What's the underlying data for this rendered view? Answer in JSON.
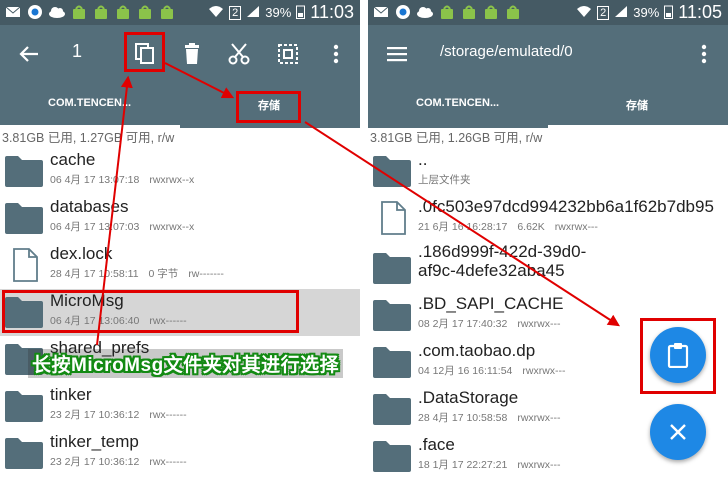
{
  "colors": {
    "statusbar": "#455a64",
    "toolbar": "#546e7a",
    "fab": "#1e88e5",
    "annotation": "#e00000",
    "caption_outline": "#138a13"
  },
  "left": {
    "status": {
      "battery": "39%",
      "time": "11:03",
      "sim": "2"
    },
    "toolbar": {
      "count": "1"
    },
    "tabs": [
      "COM.TENCEN...",
      "存储"
    ],
    "storage_info": "3.81GB 已用, 1.27GB 可用, r/w",
    "files": [
      {
        "name": "cache",
        "date": "06 4月 17 13:07:18",
        "size": "",
        "perm": "rwxrwx--x",
        "type": "folder"
      },
      {
        "name": "databases",
        "date": "06 4月 17 13:07:03",
        "size": "",
        "perm": "rwxrwx--x",
        "type": "folder"
      },
      {
        "name": "dex.lock",
        "date": "28 4月 17 10:58:11",
        "size": "0 字节",
        "perm": "rw-------",
        "type": "file"
      },
      {
        "name": "MicroMsg",
        "date": "06 4月 17 13:06:40",
        "size": "",
        "perm": "rwx------",
        "type": "folder"
      },
      {
        "name": "shared_prefs",
        "date": "",
        "size": "",
        "perm": "",
        "type": "folder"
      },
      {
        "name": "tinker",
        "date": "23 2月 17 10:36:12",
        "size": "",
        "perm": "rwx------",
        "type": "folder"
      },
      {
        "name": "tinker_temp",
        "date": "23 2月 17 10:36:12",
        "size": "",
        "perm": "rwx------",
        "type": "folder"
      }
    ]
  },
  "right": {
    "status": {
      "battery": "39%",
      "time": "11:05",
      "sim": "2"
    },
    "toolbar": {
      "path": "/storage/emulated/0"
    },
    "tabs": [
      "COM.TENCEN...",
      "存储"
    ],
    "storage_info": "3.81GB 已用, 1.26GB 可用, r/w",
    "files": [
      {
        "name": "..",
        "line2": "",
        "date": "上层文件夹",
        "size": "",
        "perm": "",
        "type": "folder"
      },
      {
        "name": ".0fc503e97dcd994232bb6a1f62b7db95",
        "line2": "",
        "date": "21 6月 16 16:28:17",
        "size": "6.62K",
        "perm": "rwxrwx---",
        "type": "file"
      },
      {
        "name": ".186d999f-422d-39d0-",
        "line2": "af9c-4defe32aba45",
        "date": "",
        "size": "",
        "perm": "",
        "type": "folder"
      },
      {
        "name": ".BD_SAPI_CACHE",
        "line2": "",
        "date": "08 2月 17 17:40:32",
        "size": "",
        "perm": "rwxrwx---",
        "type": "folder"
      },
      {
        "name": ".com.taobao.dp",
        "line2": "",
        "date": "04 12月 16 16:11:54",
        "size": "",
        "perm": "rwxrwx---",
        "type": "folder"
      },
      {
        "name": ".DataStorage",
        "line2": "",
        "date": "28 4月 17 10:58:58",
        "size": "",
        "perm": "rwxrwx---",
        "type": "folder"
      },
      {
        "name": ".face",
        "line2": "",
        "date": "18 1月 17 22:27:21",
        "size": "",
        "perm": "rwxrwx---",
        "type": "folder"
      }
    ]
  },
  "annotation": {
    "caption": "长按MicroMsg文件夹对其进行选择"
  }
}
